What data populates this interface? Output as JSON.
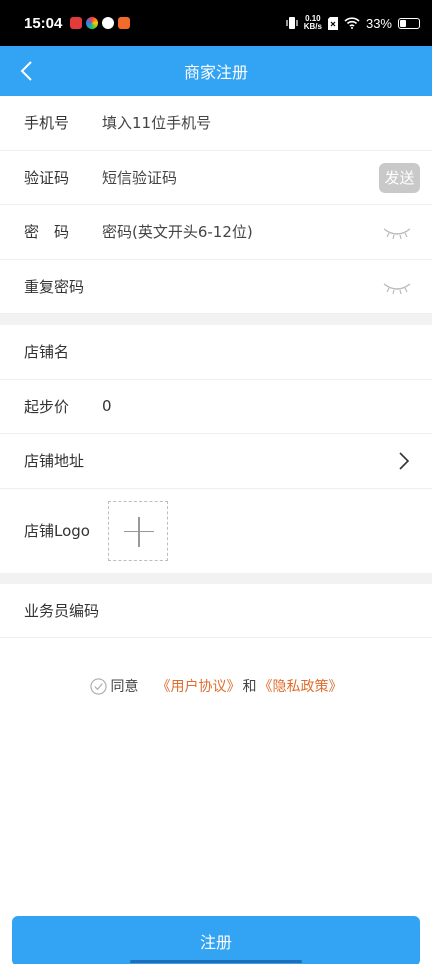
{
  "status": {
    "time": "15:04",
    "net_speed_value": "0.10",
    "net_speed_unit": "KB/s",
    "battery": "33%",
    "battery_level": 0.33,
    "icons": [
      "app-icon",
      "app-icon",
      "app-icon",
      "app-icon",
      "vibrate-icon",
      "sim-icon",
      "wifi-icon",
      "battery-icon"
    ]
  },
  "nav": {
    "title": "商家注册",
    "back_icon": "chevron-left-icon"
  },
  "form": {
    "phone": {
      "label": "手机号",
      "placeholder": "填入11位手机号"
    },
    "code": {
      "label": "验证码",
      "placeholder": "短信验证码",
      "send": "发送"
    },
    "password": {
      "label": "密　码",
      "placeholder": "密码(英文开头6-12位)"
    },
    "repeat": {
      "label": "重复密码",
      "placeholder": ""
    },
    "shop_name": {
      "label": "店铺名",
      "value": ""
    },
    "start_price": {
      "label": "起步价",
      "value": "0"
    },
    "shop_address": {
      "label": "店铺地址"
    },
    "shop_logo": {
      "label": "店铺Logo"
    },
    "salesman": {
      "label": "业务员编码",
      "value": ""
    }
  },
  "agreement": {
    "agree": "同意",
    "user_agreement": "《用户协议》",
    "and": "和",
    "privacy": "《隐私政策》"
  },
  "submit": {
    "label": "注册"
  },
  "colors": {
    "primary": "#33a3f4",
    "link": "#e06d2e",
    "send_disabled": "#c9c9c9"
  }
}
